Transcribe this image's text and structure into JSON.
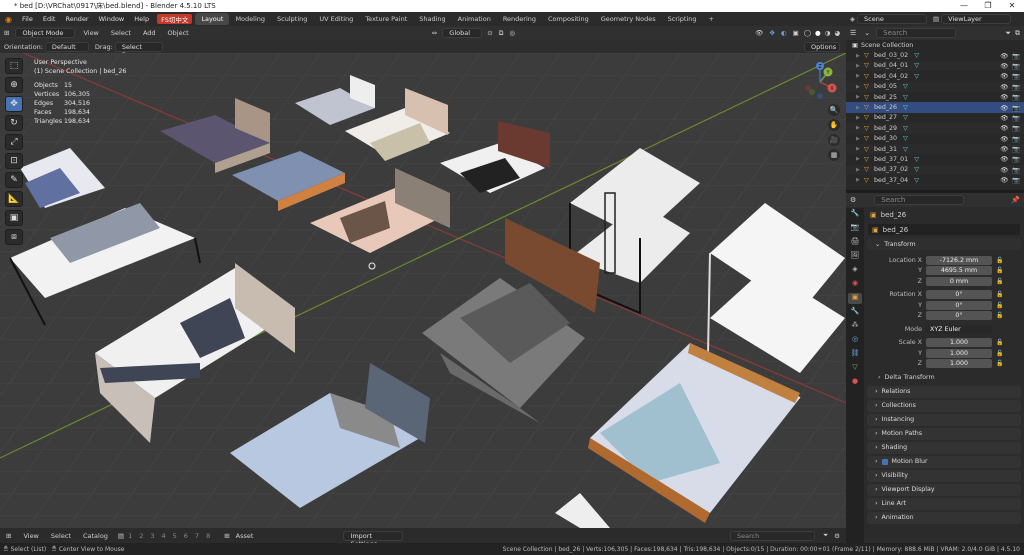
{
  "window": {
    "title": "* bed [D:\\VRChat\\0917\\床\\bed.blend] - Blender 4.5.10 LTS",
    "controls": [
      "—",
      "❐",
      "✕"
    ]
  },
  "menu": {
    "items": [
      "File",
      "Edit",
      "Render",
      "Window",
      "Help"
    ],
    "addon": "FS切中文",
    "workspaces": [
      "Layout",
      "Modeling",
      "Sculpting",
      "UV Editing",
      "Texture Paint",
      "Shading",
      "Animation",
      "Rendering",
      "Compositing",
      "Geometry Nodes",
      "Scripting"
    ],
    "active_workspace": "Layout",
    "add_tab": "+"
  },
  "topright": {
    "scene": "Scene",
    "view_layer": "ViewLayer"
  },
  "viewport_header": {
    "mode": "Object Mode",
    "menus": [
      "View",
      "Select",
      "Add",
      "Object"
    ],
    "transform_orientation": "Global"
  },
  "tool_settings": {
    "orientation_label": "Orientation:",
    "orientation_value": "Default",
    "drag_label": "Drag:",
    "drag_value": "Select Box",
    "options": "Options"
  },
  "overlay_info": {
    "view": "User Perspective",
    "collection": "(1) Scene Collection | bed_26",
    "stats": [
      {
        "label": "Objects",
        "value": "15"
      },
      {
        "label": "Vertices",
        "value": "106,305"
      },
      {
        "label": "Edges",
        "value": "304,516"
      },
      {
        "label": "Faces",
        "value": "198,634"
      },
      {
        "label": "Triangles",
        "value": "198,634"
      }
    ]
  },
  "gizmo": {
    "x": "X",
    "y": "Y",
    "z": "Z"
  },
  "outliner": {
    "search_placeholder": "Search",
    "root": "Scene Collection",
    "items": [
      "bed_03_02",
      "bed_04_01",
      "bed_04_02",
      "bed_05",
      "bed_25",
      "bed_26",
      "bed_27",
      "bed_29",
      "bed_30",
      "bed_31",
      "bed_37_01",
      "bed_37_02",
      "bed_37_04"
    ],
    "selected": "bed_26"
  },
  "properties": {
    "search_placeholder": "Search",
    "object_name": "bed_26",
    "data_name": "bed_26",
    "transform_title": "Transform",
    "location": {
      "label": "Location X",
      "x": "-7126.2 mm",
      "y": "4695.5 mm",
      "z": "0 mm"
    },
    "rotation": {
      "label": "Rotation X",
      "x": "0°",
      "y": "0°",
      "z": "0°"
    },
    "mode": {
      "label": "Mode",
      "value": "XYZ Euler"
    },
    "scale": {
      "label": "Scale X",
      "x": "1.000",
      "y": "1.000",
      "z": "1.000"
    },
    "axis_y": "Y",
    "axis_z": "Z",
    "delta": "Delta Transform",
    "panels": [
      "Relations",
      "Collections",
      "Instancing",
      "Motion Paths",
      "Shading",
      "Motion Blur",
      "Visibility",
      "Viewport Display",
      "Line Art",
      "Animation"
    ]
  },
  "timeline": {
    "menus": [
      "View",
      "Select",
      "Catalog"
    ],
    "layers": [
      "1",
      "2",
      "3",
      "4",
      "5",
      "6",
      "7",
      "8"
    ],
    "asset": "Asset",
    "import": "Import Settings",
    "search_placeholder": "Search"
  },
  "status": {
    "left": "Select (List)",
    "middle": "Center View to Mouse",
    "right": "Scene Collection | bed_26 | Verts:106,305 | Faces:198,634 | Tris:198,634 | Objects:0/15 | Duration: 00:00+01 (Frame 2/11) | Memory: 888.6 MiB | VRAM: 2.0/4.0 GiB | 4.5.10"
  },
  "colors": {
    "accent": "#4772b3",
    "selection": "#334d80",
    "viewport_bg": "#3c3c3c",
    "x_axis": "#b3413a",
    "y_axis": "#7a9a35"
  }
}
